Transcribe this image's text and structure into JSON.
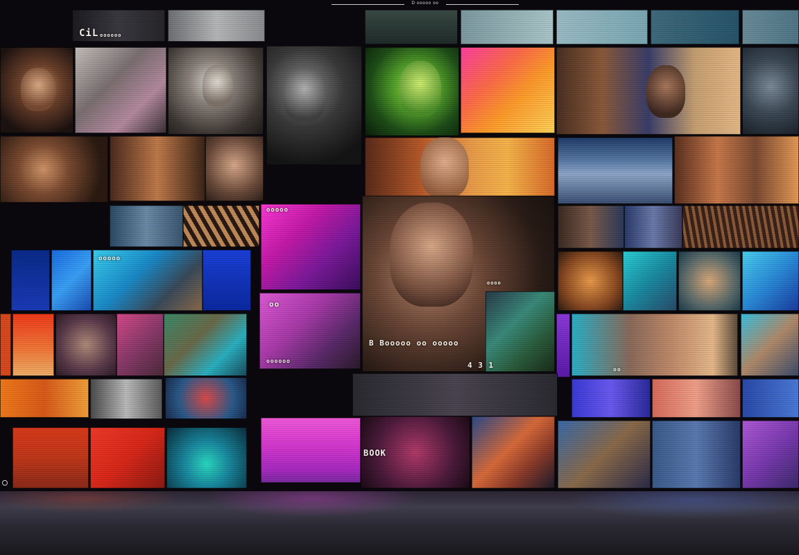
{
  "top_caption": "D ooooo oo",
  "tile_texts": {
    "top_left_sign": "CiL",
    "top_left_small": "oooooo",
    "blue_panel": "ooooo",
    "pink_panel_top": "ooooo",
    "pink_panel_left": "oo",
    "center_caption": "B  Booooo oo ooooo",
    "center_small": "ooo",
    "center_bottom": "oooooo",
    "center_number": "4 3 1",
    "night_sign": "BOOK",
    "neon_small": "oooo",
    "right_label": "oo"
  },
  "colors": {
    "wall": "#0a080d",
    "magenta": "#d63fd6",
    "orange": "#f07a22",
    "cyan": "#23b6d6",
    "red": "#d82a1e"
  }
}
